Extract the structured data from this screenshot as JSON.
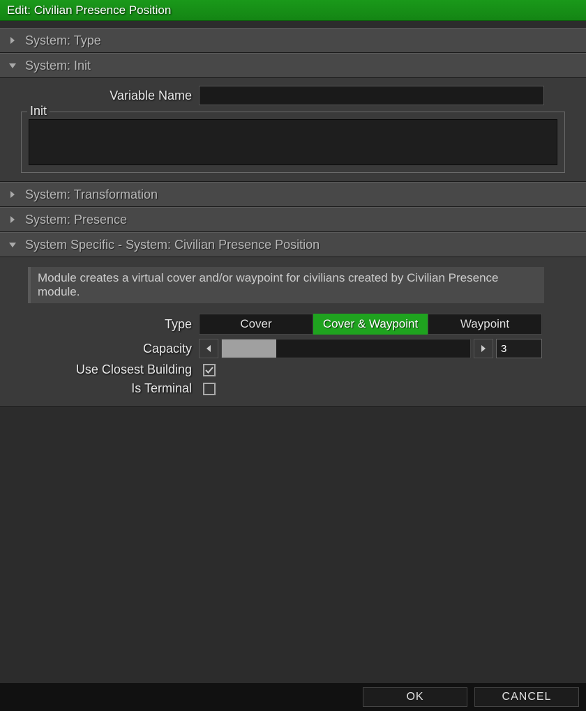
{
  "title": "Edit: Civilian Presence Position",
  "sections": {
    "type": {
      "label": "System: Type",
      "expanded": false
    },
    "init": {
      "label": "System: Init",
      "expanded": true,
      "variable_name_label": "Variable Name",
      "variable_name_value": "",
      "init_legend": "Init",
      "init_value": ""
    },
    "transformation": {
      "label": "System: Transformation",
      "expanded": false
    },
    "presence": {
      "label": "System: Presence",
      "expanded": false
    },
    "specific": {
      "label": "System Specific - System: Civilian Presence Position",
      "expanded": true,
      "description": "Module creates a virtual cover and/or waypoint for civilians created by Civilian Presence module.",
      "type_label": "Type",
      "type_options": [
        "Cover",
        "Cover & Waypoint",
        "Waypoint"
      ],
      "type_selected": 1,
      "capacity_label": "Capacity",
      "capacity_value": "3",
      "capacity_fill_pct": 22,
      "use_closest_label": "Use Closest Building",
      "use_closest_checked": true,
      "is_terminal_label": "Is Terminal",
      "is_terminal_checked": false
    }
  },
  "footer": {
    "ok": "OK",
    "cancel": "CANCEL"
  }
}
